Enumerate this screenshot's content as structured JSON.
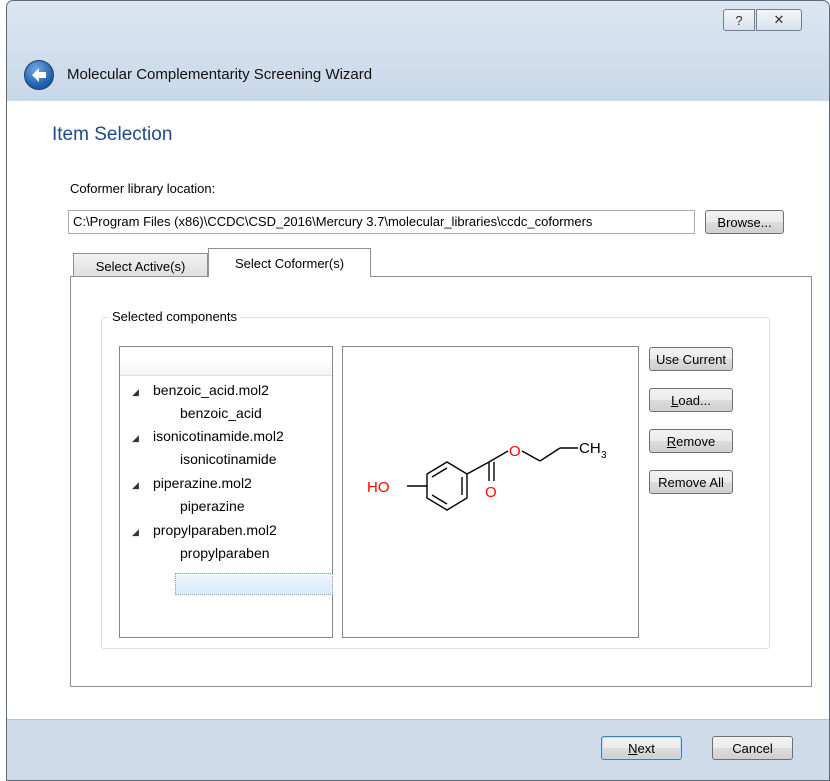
{
  "window": {
    "title": "Molecular Complementarity Screening Wizard",
    "help_glyph": "?",
    "close_glyph": "✕"
  },
  "page": {
    "title": "Item Selection",
    "library_label": "Coformer library location:",
    "library_path": "C:\\Program Files (x86)\\CCDC\\CSD_2016\\Mercury 3.7\\molecular_libraries\\ccdc_coformers",
    "browse_label": "Browse..."
  },
  "tabs": [
    {
      "label": "Select Active(s)"
    },
    {
      "label": "Select Coformer(s)"
    }
  ],
  "group": {
    "label": "Selected components"
  },
  "tree": {
    "items": [
      {
        "file": "benzoic_acid.mol2",
        "child": "benzoic_acid"
      },
      {
        "file": "isonicotinamide.mol2",
        "child": "isonicotinamide"
      },
      {
        "file": "piperazine.mol2",
        "child": "piperazine"
      },
      {
        "file": "propylparaben.mol2",
        "child": "propylparaben"
      }
    ]
  },
  "structure": {
    "ho_label": "HO",
    "o_ester": "O",
    "o_carbonyl": "O",
    "ch3_main": "CH",
    "ch3_sub": "3",
    "heteroatom_color": "#ff0000",
    "bond_color": "#000000"
  },
  "side_buttons": {
    "use_current": "Use Current",
    "load_prefix": "L",
    "load_rest": "oad...",
    "remove_prefix": "R",
    "remove_rest": "emove",
    "remove_all": "Remove All"
  },
  "footer": {
    "next_prefix": "N",
    "next_rest": "ext",
    "cancel": "Cancel"
  }
}
